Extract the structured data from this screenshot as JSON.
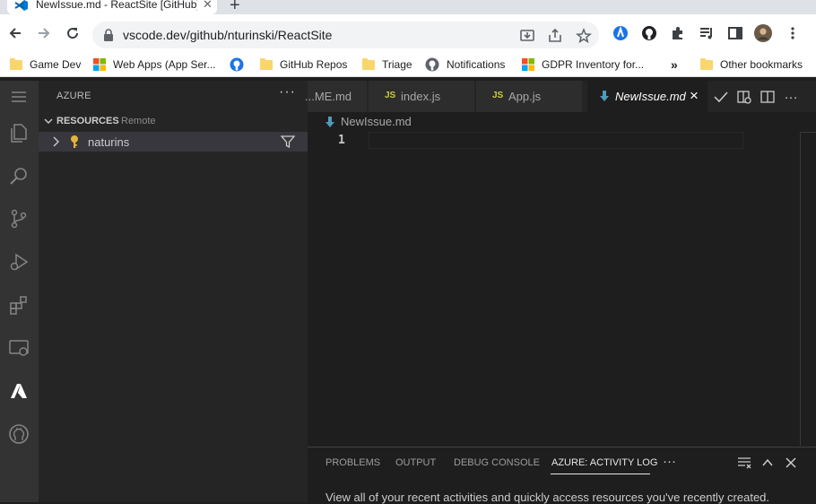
{
  "browser": {
    "tab_title": "NewIssue.md - ReactSite [GitHub]",
    "url": "vscode.dev/github/nturinski/ReactSite",
    "bookmarks": [
      {
        "label": "Game Dev",
        "icon": "folder-icon"
      },
      {
        "label": "Web Apps (App Ser...",
        "icon": "microsoft-icon"
      },
      {
        "label": "",
        "icon": "github-icon"
      },
      {
        "label": "GitHub Repos",
        "icon": "folder-icon"
      },
      {
        "label": "Triage",
        "icon": "folder-icon"
      },
      {
        "label": "Notifications",
        "icon": "github-icon"
      },
      {
        "label": "GDPR Inventory for...",
        "icon": "microsoft-icon"
      }
    ],
    "more_bookmarks": "»",
    "other_bookmarks": "Other bookmarks"
  },
  "sidebar": {
    "title": "AZURE",
    "more": "···",
    "resources_title": "RESOURCES",
    "resources_sub": "Remote",
    "tree_item": "naturins"
  },
  "editor": {
    "tabs": [
      {
        "label": "...ME.md",
        "kind": "md"
      },
      {
        "label": "index.js",
        "kind": "js",
        "badge": "JS"
      },
      {
        "label": "App.js",
        "kind": "js",
        "badge": "JS"
      },
      {
        "label": "NewIssue.md",
        "kind": "md",
        "active": true
      }
    ],
    "tab_close": "×",
    "breadcrumb": "NewIssue.md",
    "line_number": "1"
  },
  "panel": {
    "tabs": [
      "PROBLEMS",
      "OUTPUT",
      "DEBUG CONSOLE",
      "AZURE: ACTIVITY LOG"
    ],
    "more": "···",
    "message": "View all of your recent activities and quickly access resources you've recently created."
  },
  "colors": {
    "activitybar": "#333333",
    "sidebar": "#252526",
    "editor": "#1e1e1e",
    "js_badge": "#cbcb41",
    "md_icon": "#519aba",
    "azure_blue": "#0078d4"
  }
}
